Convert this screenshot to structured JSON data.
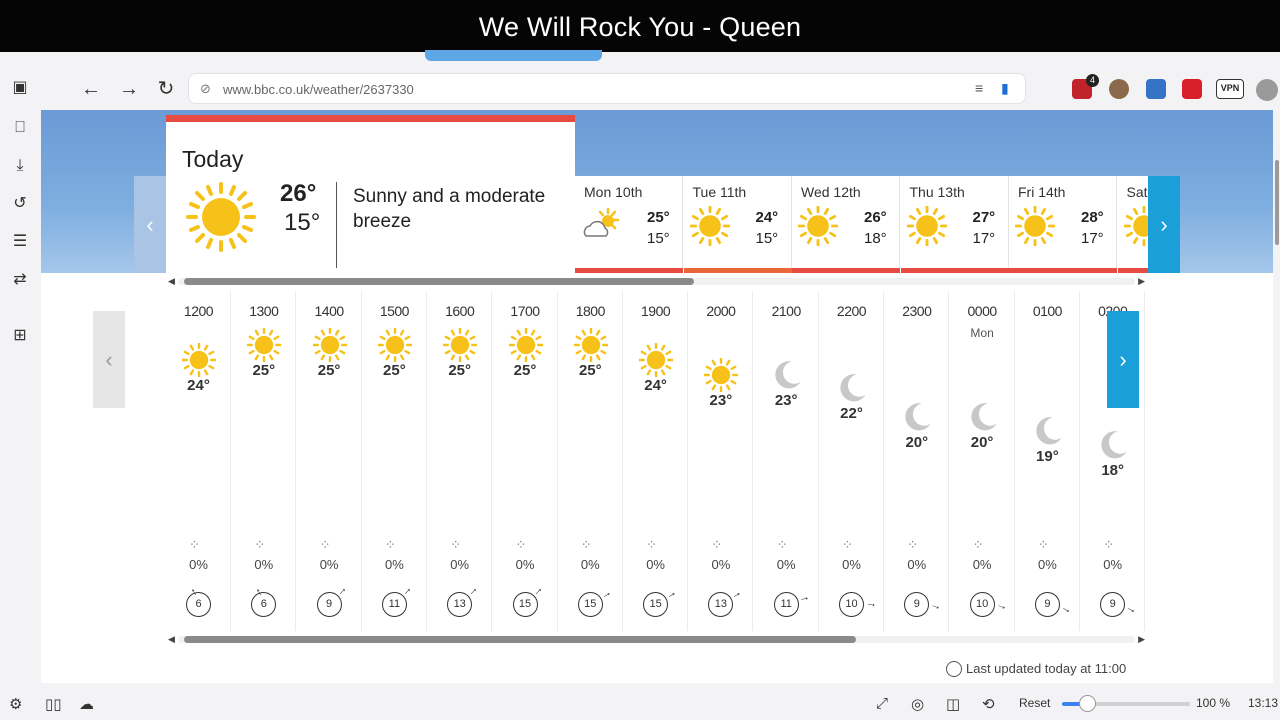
{
  "overlay": {
    "title": "We Will Rock You - Queen"
  },
  "browser": {
    "url": "www.bbc.co.uk/weather/2637330",
    "badge_count": "4",
    "vpn_label": "VPN"
  },
  "today": {
    "title": "Today",
    "high": "26°",
    "low": "15°",
    "description": "Sunny and a moderate breeze",
    "icon": "sun-icon"
  },
  "days": [
    {
      "name": "Mon 10th",
      "high": "25°",
      "low": "15°",
      "icon": "sun-cloud-icon"
    },
    {
      "name": "Tue 11th",
      "high": "24°",
      "low": "15°",
      "icon": "sun-icon"
    },
    {
      "name": "Wed 12th",
      "high": "26°",
      "low": "18°",
      "icon": "sun-icon"
    },
    {
      "name": "Thu 13th",
      "high": "27°",
      "low": "17°",
      "icon": "sun-icon"
    },
    {
      "name": "Fri 14th",
      "high": "28°",
      "low": "17°",
      "icon": "sun-icon"
    },
    {
      "name": "Sat",
      "high": "",
      "low": "",
      "icon": "sun-icon"
    }
  ],
  "hours": [
    {
      "time": "1200",
      "day": "",
      "temp": "24°",
      "icon": "sun-icon",
      "rain": "0%",
      "wind": "6"
    },
    {
      "time": "1300",
      "day": "",
      "temp": "25°",
      "icon": "sun-icon",
      "rain": "0%",
      "wind": "6"
    },
    {
      "time": "1400",
      "day": "",
      "temp": "25°",
      "icon": "sun-icon",
      "rain": "0%",
      "wind": "9"
    },
    {
      "time": "1500",
      "day": "",
      "temp": "25°",
      "icon": "sun-icon",
      "rain": "0%",
      "wind": "11"
    },
    {
      "time": "1600",
      "day": "",
      "temp": "25°",
      "icon": "sun-icon",
      "rain": "0%",
      "wind": "13"
    },
    {
      "time": "1700",
      "day": "",
      "temp": "25°",
      "icon": "sun-icon",
      "rain": "0%",
      "wind": "15"
    },
    {
      "time": "1800",
      "day": "",
      "temp": "25°",
      "icon": "sun-icon",
      "rain": "0%",
      "wind": "15"
    },
    {
      "time": "1900",
      "day": "",
      "temp": "24°",
      "icon": "sun-icon",
      "rain": "0%",
      "wind": "15"
    },
    {
      "time": "2000",
      "day": "",
      "temp": "23°",
      "icon": "sun-icon",
      "rain": "0%",
      "wind": "13"
    },
    {
      "time": "2100",
      "day": "",
      "temp": "23°",
      "icon": "moon-icon",
      "rain": "0%",
      "wind": "11"
    },
    {
      "time": "2200",
      "day": "",
      "temp": "22°",
      "icon": "moon-icon",
      "rain": "0%",
      "wind": "10"
    },
    {
      "time": "2300",
      "day": "",
      "temp": "20°",
      "icon": "moon-icon",
      "rain": "0%",
      "wind": "9"
    },
    {
      "time": "0000",
      "day": "Mon",
      "temp": "20°",
      "icon": "moon-icon",
      "rain": "0%",
      "wind": "10"
    },
    {
      "time": "0100",
      "day": "",
      "temp": "19°",
      "icon": "moon-icon",
      "rain": "0%",
      "wind": "9"
    },
    {
      "time": "0200",
      "day": "",
      "temp": "18°",
      "icon": "moon-icon",
      "rain": "0%",
      "wind": "9"
    }
  ],
  "last_updated": "Last updated today at 11:00",
  "status": {
    "reset_label": "Reset",
    "zoom": "100 %",
    "clock": "13:13",
    "zoom_level": 1.0
  },
  "colors": {
    "accent_red": "#e64a40",
    "nav_blue": "#1a9fd9",
    "sun": "#f6c21a"
  }
}
